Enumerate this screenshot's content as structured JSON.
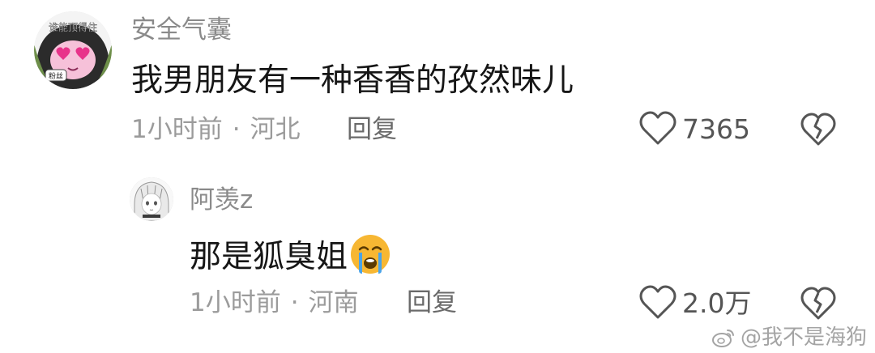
{
  "comment": {
    "avatar_text": "谁能顶得住",
    "avatar_badge": "粉丝",
    "username": "安全气囊",
    "text": "我男朋友有一种香香的孜然味儿",
    "time": "1小时前",
    "separator": "·",
    "location": "河北",
    "reply_label": "回复",
    "like_count": "7365"
  },
  "reply": {
    "username": "阿羡z",
    "text": "那是狐臭姐",
    "emoji": "loudly-crying-face-emoji",
    "time": "1小时前",
    "separator": "·",
    "location": "河南",
    "reply_label": "回复",
    "like_count": "2.0万"
  },
  "watermark": {
    "text": "@我不是海狗",
    "icon": "weibo-icon"
  },
  "colors": {
    "username": "#8a8a8a",
    "comment_text": "#161616",
    "meta": "#9b9b9b",
    "icon": "#555555",
    "emoji_face": "#f7b733",
    "emoji_tears": "#4aa3e8"
  }
}
